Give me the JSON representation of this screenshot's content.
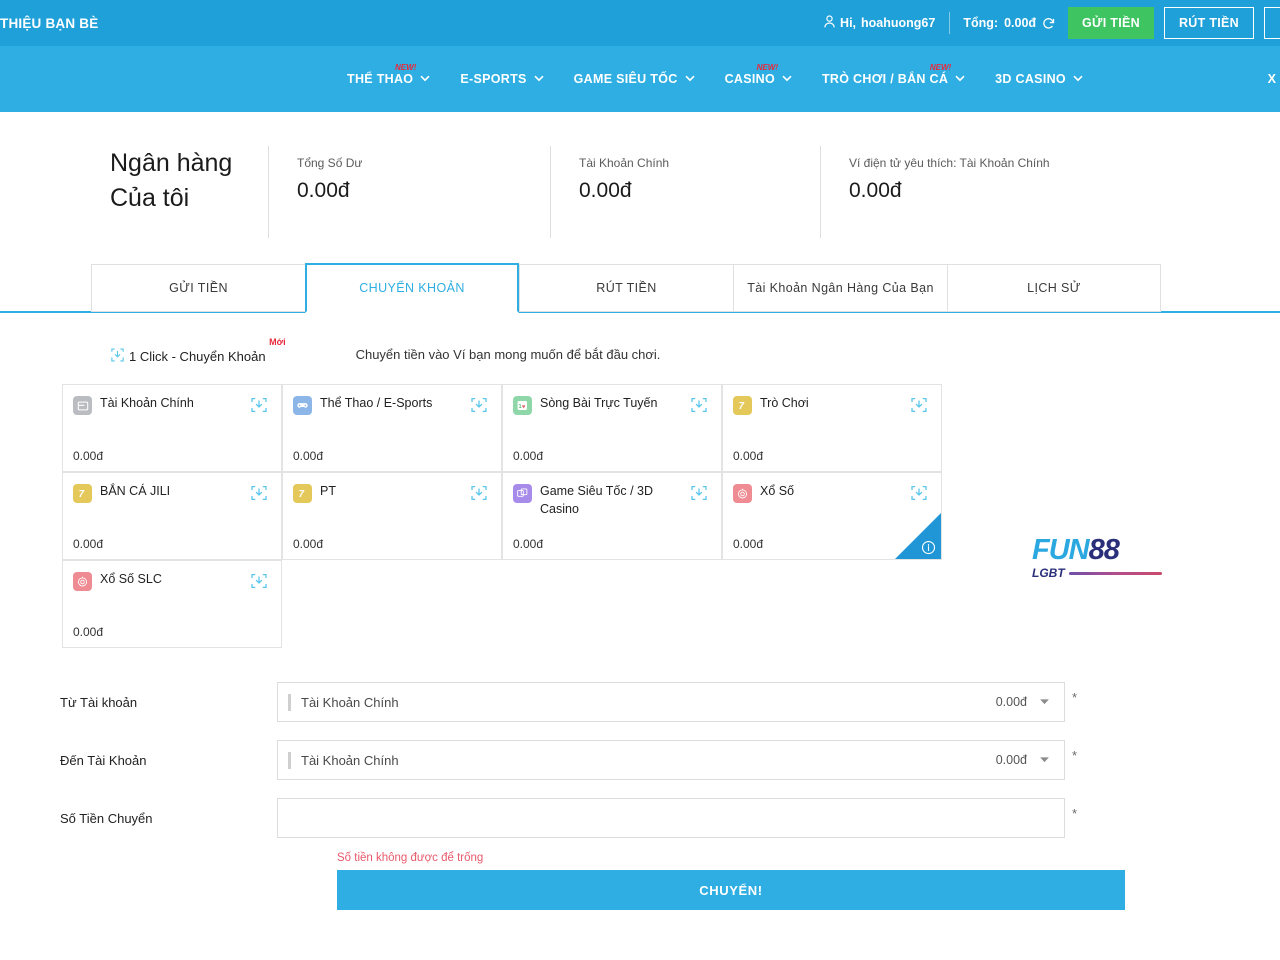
{
  "topbar": {
    "referral_label": "THIỆU BẠN BÈ",
    "greeting": "Hi,",
    "username": "hoahuong67",
    "total_label": "Tổng:",
    "total_value": "0.00đ",
    "deposit_label": "GỬI TIỀN",
    "withdraw_label": "RÚT TIỀN",
    "user_icon": "user-icon",
    "refresh_icon": "refresh-icon"
  },
  "nav": {
    "items": [
      {
        "label": "THỂ THAO",
        "badge": "NEW!",
        "caret": "⌄"
      },
      {
        "label": "E-SPORTS",
        "badge": "",
        "caret": "⌄"
      },
      {
        "label": "GAME SIÊU TỐC",
        "badge": "",
        "caret": "⌄"
      },
      {
        "label": "CASINO",
        "badge": "NEW!",
        "caret": "⌄"
      },
      {
        "label": "TRÒ CHƠI / BẮN CÁ",
        "badge": "NEW!",
        "caret": "⌄"
      },
      {
        "label": "3D CASINO",
        "badge": "",
        "caret": "⌄"
      }
    ],
    "edge_label": "X"
  },
  "summary": {
    "title_line1": "Ngân hàng",
    "title_line2": "Của tôi",
    "cells": [
      {
        "label": "Tổng Số Dư",
        "value": "0.00đ"
      },
      {
        "label": "Tài Khoản Chính",
        "value": "0.00đ"
      },
      {
        "label": "Ví điện tử yêu thích: Tài Khoản Chính",
        "value": "0.00đ"
      }
    ]
  },
  "tabs": [
    {
      "label": "GỬI TIỀN",
      "active": false
    },
    {
      "label": "CHUYỂN KHOẢN",
      "active": true
    },
    {
      "label": "RÚT TIỀN",
      "active": false
    },
    {
      "label": "Tài Khoản Ngân Hàng Của Bạn",
      "active": false
    },
    {
      "label": "LỊCH SỬ",
      "active": false
    }
  ],
  "oneclick": {
    "label": "1 Click - Chuyển Khoản",
    "badge": "Mới",
    "hint": "Chuyển tiền vào Ví bạn mong muốn để bắt đầu chơi.",
    "icon": "download-box-icon"
  },
  "wallets": [
    {
      "name": "Tài Khoản Chính",
      "balance": "0.00đ",
      "icon": "wallet-main-icon",
      "icon_bg": "#b9bcc0",
      "icon_glyph": "▤",
      "has_info_corner": false
    },
    {
      "name": "Thể Thao / E-Sports",
      "balance": "0.00đ",
      "icon": "gamepad-icon",
      "icon_bg": "#8db6e8",
      "icon_glyph": "ἺE",
      "has_info_corner": false
    },
    {
      "name": "Sòng Bài Trực Tuyến",
      "balance": "0.00đ",
      "icon": "live-casino-icon",
      "icon_bg": "#8fd6a9",
      "icon_glyph": "10",
      "has_info_corner": false
    },
    {
      "name": "Trò Chơi",
      "balance": "0.00đ",
      "icon": "slot-seven-icon",
      "icon_bg": "#e5c martinez",
      "icon_glyph": "7",
      "has_info_corner": false
    },
    {
      "name": "BẮN CÁ JILI",
      "balance": "0.00đ",
      "icon": "slot-seven-icon",
      "icon_bg": "#e5c85a",
      "icon_glyph": "7",
      "has_info_corner": false
    },
    {
      "name": "PT",
      "balance": "0.00đ",
      "icon": "slot-seven-icon",
      "icon_bg": "#e5c85a",
      "icon_glyph": "7",
      "has_info_corner": false
    },
    {
      "name": "Game Siêu Tốc / 3D Casino",
      "balance": "0.00đ",
      "icon": "dice-3d-icon",
      "icon_bg": "#a68bea",
      "icon_glyph": "⚅",
      "has_info_corner": false
    },
    {
      "name": "Xổ Số",
      "balance": "0.00đ",
      "icon": "lottery-ball-icon",
      "icon_bg": "#ef8b92",
      "icon_glyph": "◎",
      "has_info_corner": true
    },
    {
      "name": "Xổ Số SLC",
      "balance": "0.00đ",
      "icon": "lottery-ball-icon",
      "icon_bg": "#ef8b92",
      "icon_glyph": "◎",
      "has_info_corner": false
    }
  ],
  "brand": {
    "fun": "FUN",
    "eightyeight": "88",
    "sub": "LGBT"
  },
  "form": {
    "from_label": "Từ Tài khoản",
    "from_value": "Tài Khoản Chính",
    "from_amount": "0.00đ",
    "to_label": "Đến Tài Khoản",
    "to_value": "Tài Khoản Chính",
    "to_amount": "0.00đ",
    "amount_label": "Số Tiền Chuyển",
    "amount_value": "",
    "amount_placeholder": "",
    "required_mark": "*",
    "error": "Số tiền không được để trống",
    "submit_label": "CHUYỂN!"
  }
}
